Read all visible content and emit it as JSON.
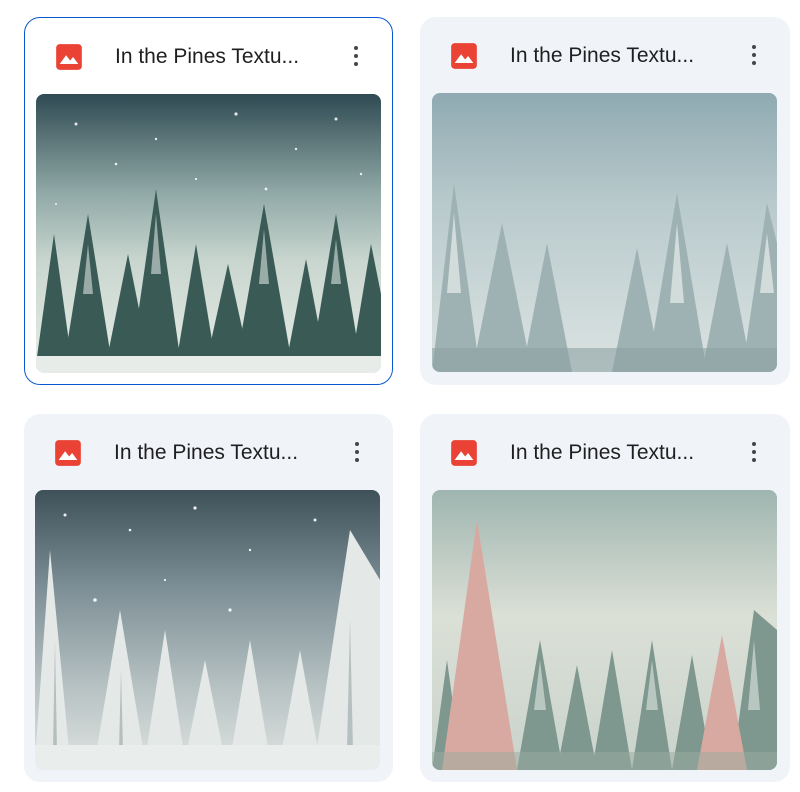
{
  "colors": {
    "card_bg": "#f0f4f9",
    "selected_border": "#0b57d0",
    "image_icon": "#ea4335",
    "title_text": "#1f1f1f"
  },
  "files": [
    {
      "title": "In the Pines Textu...",
      "icon": "image-file-icon",
      "selected": true,
      "thumbnail": "snowy-pine-forest-night"
    },
    {
      "title": "In the Pines Textu...",
      "icon": "image-file-icon",
      "selected": false,
      "thumbnail": "frosted-pines-blue-mist"
    },
    {
      "title": "In the Pines Textu...",
      "icon": "image-file-icon",
      "selected": false,
      "thumbnail": "starry-night-white-pines"
    },
    {
      "title": "In the Pines Textu...",
      "icon": "image-file-icon",
      "selected": false,
      "thumbnail": "pink-and-green-pines"
    }
  ]
}
